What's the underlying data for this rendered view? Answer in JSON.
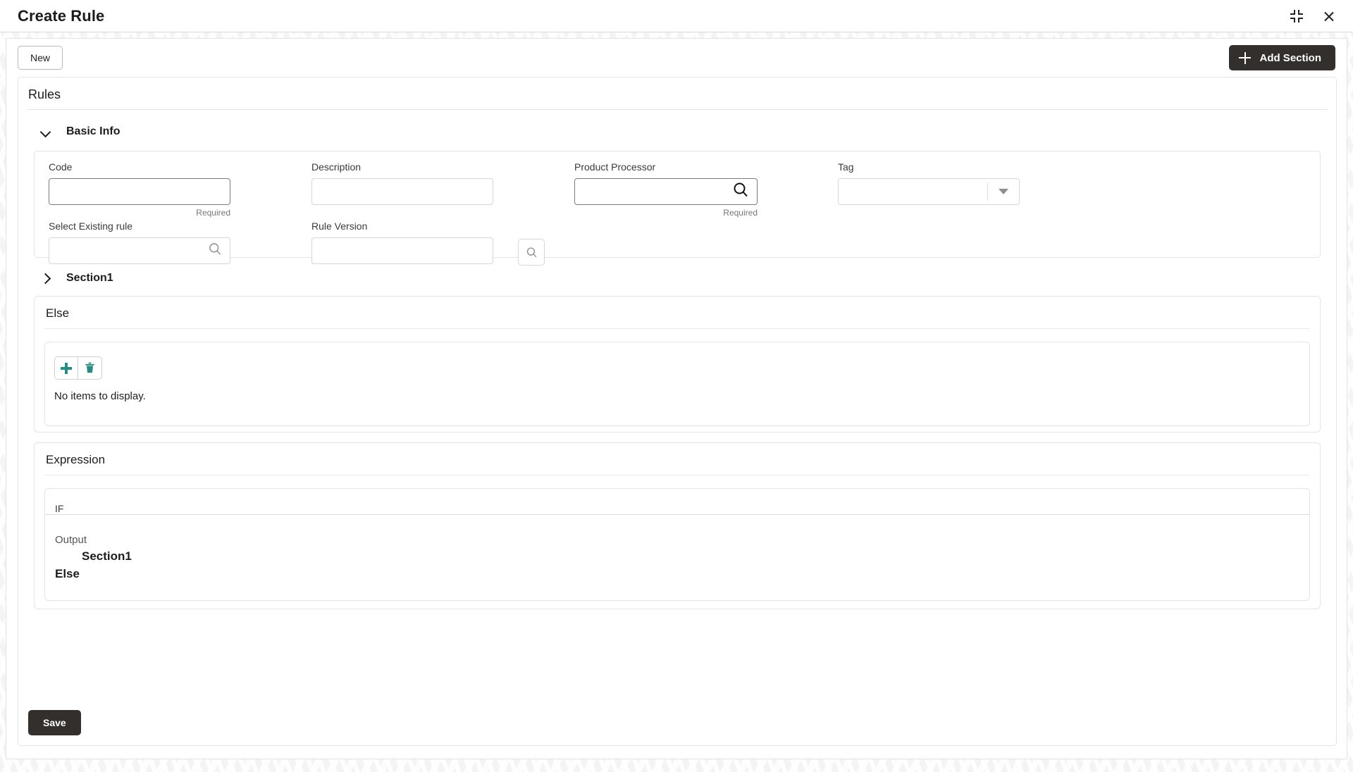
{
  "window": {
    "title": "Create Rule",
    "minimize_icon": "minimize-icon",
    "close_icon": "close-icon"
  },
  "toolbar": {
    "new_label": "New",
    "add_section_label": "Add Section",
    "add_section_icon": "plus-icon"
  },
  "panel": {
    "title": "Rules"
  },
  "basic_info": {
    "label": "Basic Info",
    "expanded": true,
    "chevron_icon": "chevron-down-icon",
    "fields": {
      "code": {
        "label": "Code",
        "value": "",
        "placeholder": "",
        "helper": "Required"
      },
      "description": {
        "label": "Description",
        "value": "",
        "placeholder": ""
      },
      "product_processor": {
        "label": "Product Processor",
        "value": "",
        "placeholder": "",
        "helper": "Required",
        "icon": "search-icon"
      },
      "tag": {
        "label": "Tag",
        "value": "",
        "icon": "chevron-down-icon"
      },
      "select_existing_rule": {
        "label": "Select Existing rule",
        "value": "",
        "placeholder": "",
        "icon": "search-icon"
      },
      "rule_version": {
        "label": "Rule Version",
        "value": "",
        "placeholder": ""
      },
      "version_search_button": {
        "icon": "search-icon"
      }
    }
  },
  "section1": {
    "label": "Section1",
    "expanded": false,
    "chevron_icon": "chevron-right-icon"
  },
  "else_card": {
    "title": "Else",
    "add_icon": "plus-icon",
    "delete_icon": "trash-icon",
    "empty_message": "No items to display."
  },
  "expression_card": {
    "title": "Expression",
    "if_label": "IF"
  },
  "output": {
    "label": "Output",
    "section": "Section1",
    "else": "Else"
  },
  "footer": {
    "save_label": "Save"
  },
  "colors": {
    "accent_teal": "#2b8a81",
    "button_dark": "#332f2d",
    "border": "#e4e4e4",
    "helper_text": "#767676"
  }
}
